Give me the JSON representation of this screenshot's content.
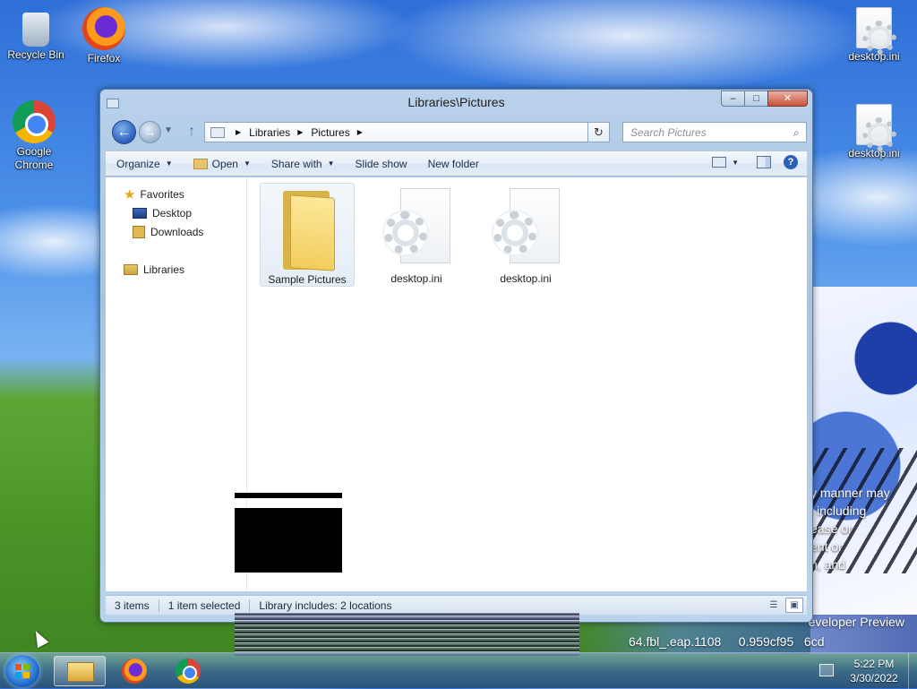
{
  "desktop": {
    "icons": [
      {
        "label": "Recycle Bin",
        "icon": "recycle-bin-icon"
      },
      {
        "label": "Firefox",
        "icon": "firefox-icon"
      },
      {
        "label": "Google Chrome",
        "icon": "chrome-icon"
      },
      {
        "label": "desktop.ini",
        "icon": "settings-file-icon"
      },
      {
        "label": "desktop.ini",
        "icon": "settings-file-icon"
      }
    ],
    "wallpaper_text": {
      "side_lines": [
        "l",
        "y manner may",
        "l including",
        "ease or",
        "ent or",
        "n, and"
      ],
      "bottom_line_1": "eveloper Preview",
      "bottom_line_2": "64.fbl_.eap.1108",
      "bottom_line_3": "0.959cf95",
      "bottom_line_4": "6cd"
    }
  },
  "window": {
    "title": "Libraries\\Pictures",
    "caption_buttons": {
      "minimize": "–",
      "maximize": "□",
      "close": "✕"
    },
    "navigation": {
      "back": "←",
      "forward": "→",
      "up": "↑",
      "breadcrumb": [
        "Libraries",
        "Pictures"
      ],
      "refresh": "↻",
      "search_placeholder": "Search Pictures"
    },
    "command_bar": {
      "organize": "Organize",
      "open": "Open",
      "share_with": "Share with",
      "slide_show": "Slide show",
      "new_folder": "New folder"
    },
    "nav_pane": {
      "favorites": "Favorites",
      "desktop": "Desktop",
      "downloads": "Downloads",
      "libraries": "Libraries"
    },
    "files": [
      {
        "name": "Sample Pictures",
        "type": "folder",
        "selected": true
      },
      {
        "name": "desktop.ini",
        "type": "settings-file",
        "selected": false
      },
      {
        "name": "desktop.ini",
        "type": "settings-file",
        "selected": false
      }
    ],
    "status_bar": {
      "items_count": "3 items",
      "selected": "1 item selected",
      "library_info": "Library includes: 2 locations"
    }
  },
  "taskbar": {
    "pinned": [
      "Windows Explorer",
      "Firefox",
      "Google Chrome"
    ],
    "active": "Windows Explorer",
    "clock": {
      "time": "5:22 PM",
      "date": "3/30/2022"
    }
  }
}
